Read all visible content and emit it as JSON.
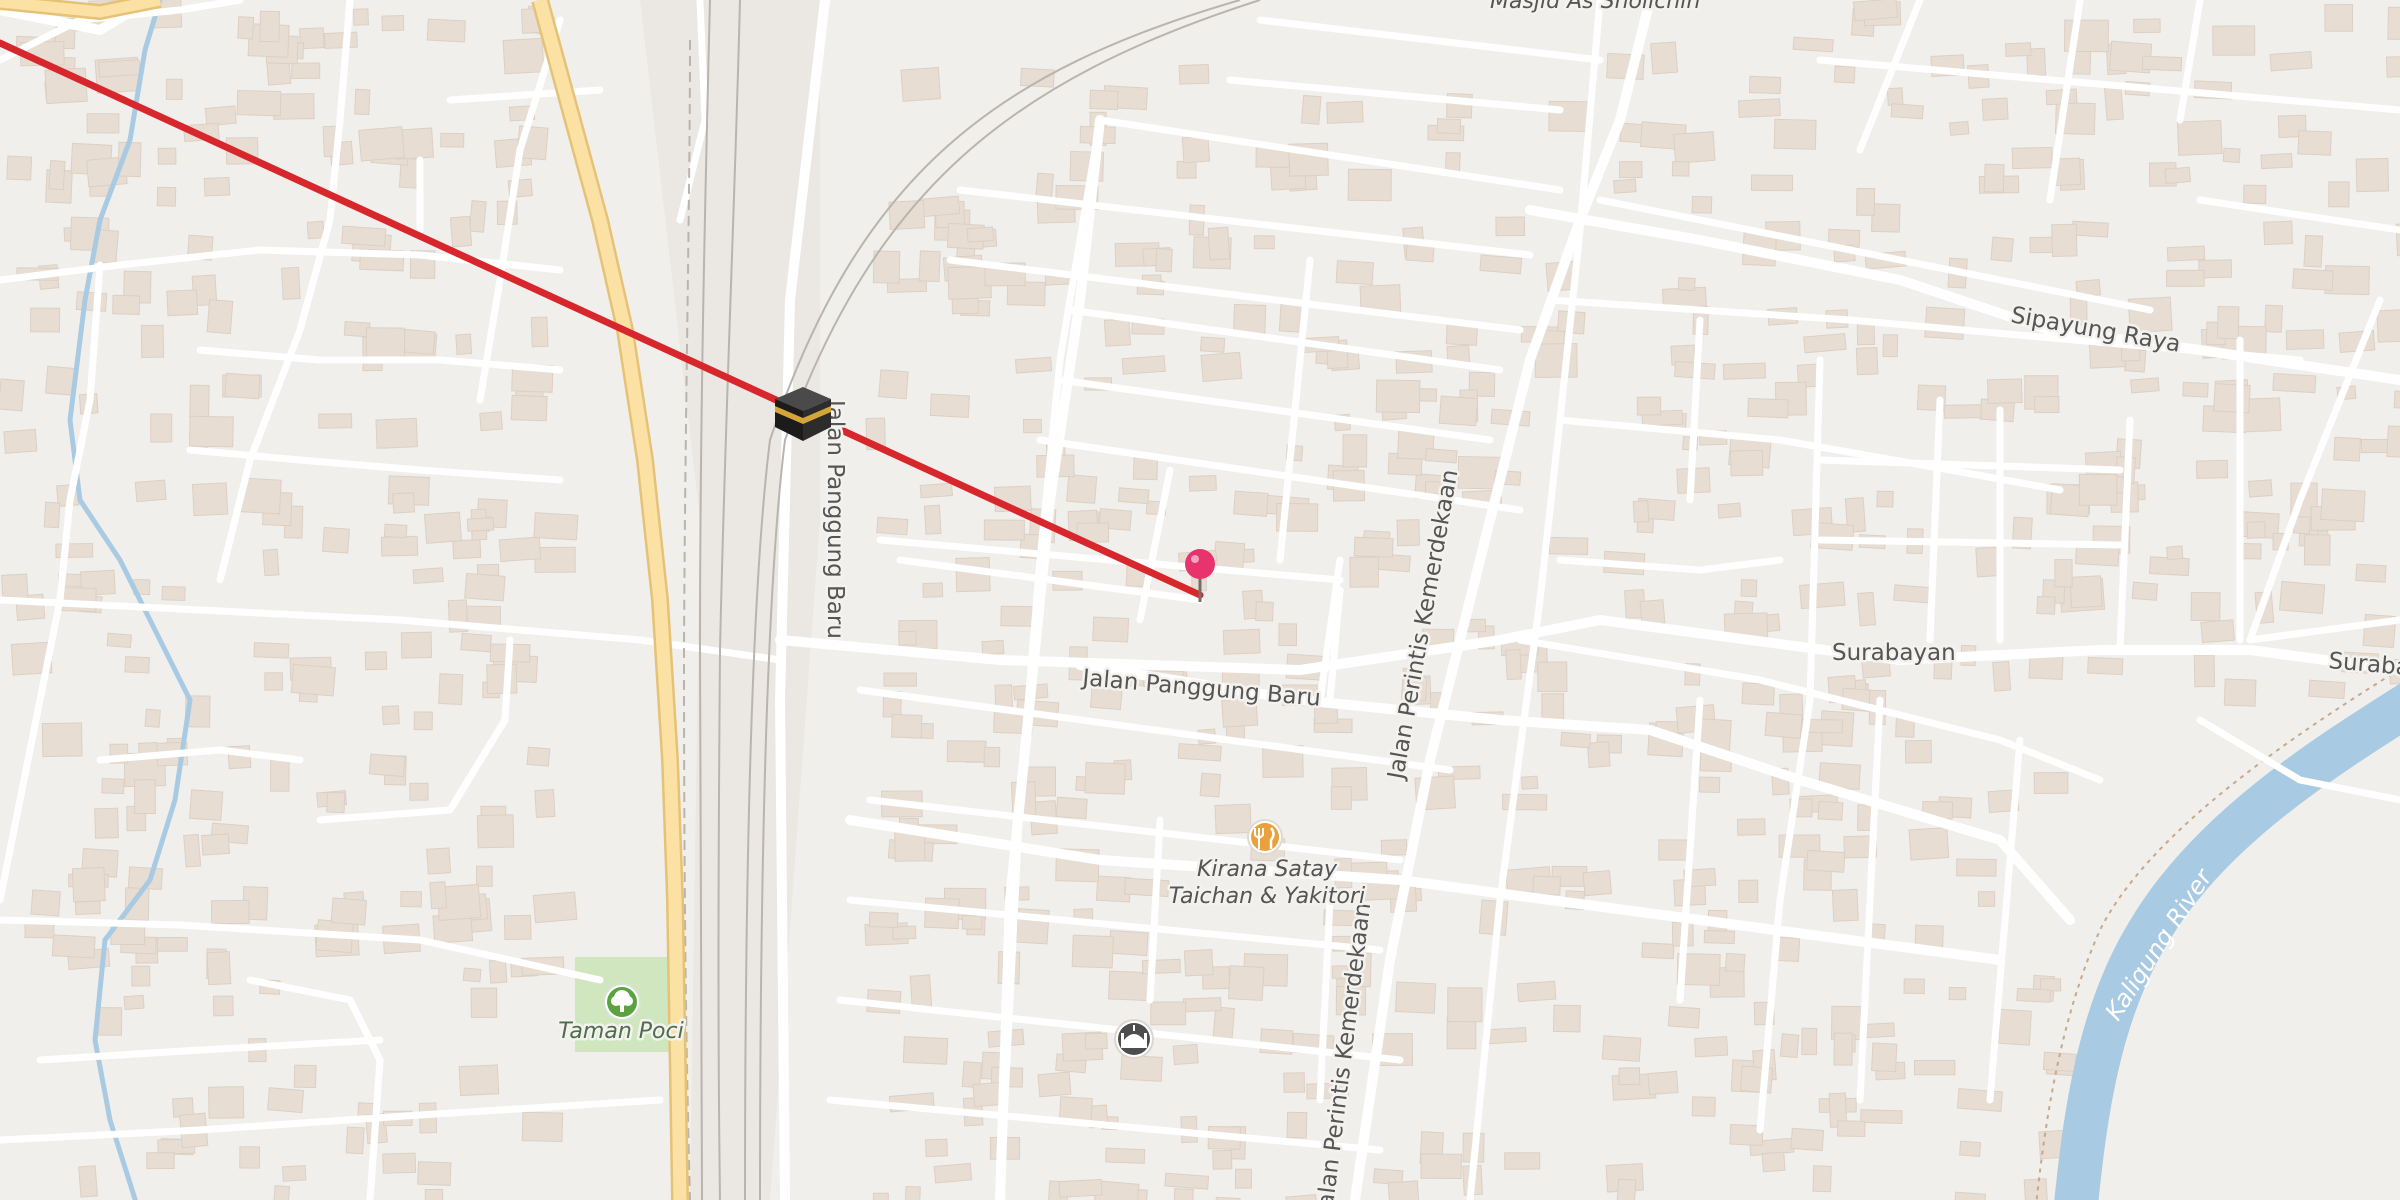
{
  "map": {
    "roads": [
      {
        "id": "jalan-panggung-baru-v",
        "label": "Jalan Panggung Baru"
      },
      {
        "id": "jalan-panggung-baru-h",
        "label": "Jalan Panggung Baru"
      },
      {
        "id": "jalan-perintis-kemerdekaan-n",
        "label": "Jalan Perintis Kemerdekaan"
      },
      {
        "id": "jalan-perintis-kemerdekaan-s",
        "label": "Jalan Perintis Kemerdekaan"
      },
      {
        "id": "sipayung-raya",
        "label": "Sipayung Raya"
      },
      {
        "id": "surabayan",
        "label": "Surabayan"
      },
      {
        "id": "surabayan-edge",
        "label": "Surabayan"
      }
    ],
    "water": [
      {
        "id": "kaligung-river",
        "label": "Kaligung River"
      }
    ],
    "pois": [
      {
        "id": "masjid-as-sholichin",
        "label": "Masjid As Sholichin",
        "icon": "mosque-icon"
      },
      {
        "id": "kirana-satay",
        "line1": "Kirana Satay",
        "line2": "Taichan & Yakitori",
        "icon": "restaurant-icon"
      },
      {
        "id": "taman-poci",
        "label": "Taman Poci",
        "icon": "park-tree-icon"
      },
      {
        "id": "unnamed-mosque",
        "label": "",
        "icon": "mosque-icon"
      }
    ],
    "markers": {
      "kaaba": {
        "icon": "kaaba-icon"
      },
      "location_pin": {
        "icon": "location-pin-icon",
        "color": "#e8336e"
      },
      "qibla_line": {
        "color": "#d8262d"
      }
    },
    "colors": {
      "background": "#f1efec",
      "road": "#ffffff",
      "primary_road": "#fbe1a4",
      "primary_road_casing": "#e6c277",
      "building": "#e7ddd3",
      "water": "#a8cbe3",
      "park": "#cfe6bf",
      "railway": "#b9b4ae"
    }
  }
}
